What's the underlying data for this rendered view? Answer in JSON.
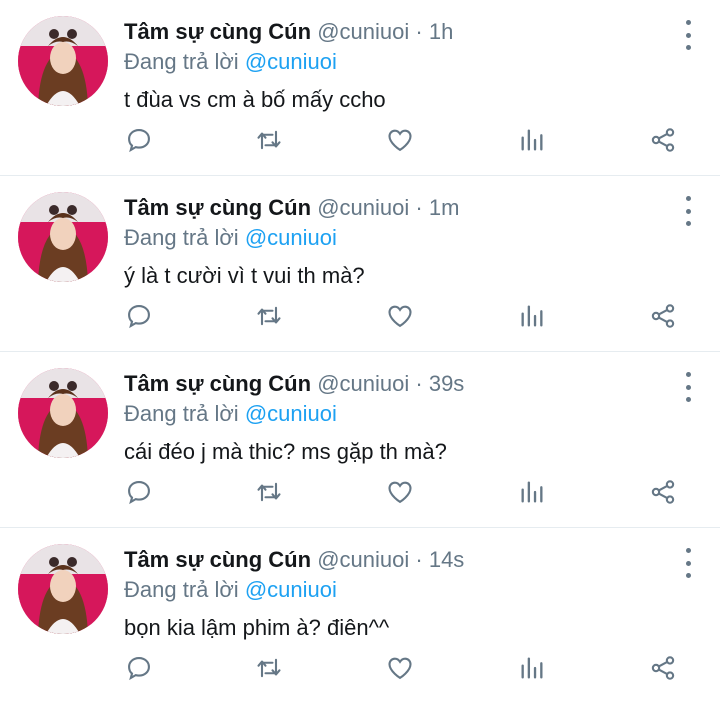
{
  "tweets": [
    {
      "name": "Tâm sự cùng Cún",
      "handle": "@cuniuoi",
      "dot": "·",
      "time": "1h",
      "reply_prefix": "Đang trả lời",
      "reply_to": "@cuniuoi",
      "text": "t đùa vs cm à bố mấy ccho"
    },
    {
      "name": "Tâm sự cùng Cún",
      "handle": "@cuniuoi",
      "dot": "·",
      "time": "1m",
      "reply_prefix": "Đang trả lời",
      "reply_to": "@cuniuoi",
      "text": "ý là t cười vì t vui th mà?"
    },
    {
      "name": "Tâm sự cùng Cún",
      "handle": "@cuniuoi",
      "dot": "·",
      "time": "39s",
      "reply_prefix": "Đang trả lời",
      "reply_to": "@cuniuoi",
      "text": "cái đéo j mà thic? ms gặp th mà?"
    },
    {
      "name": "Tâm sự cùng Cún",
      "handle": "@cuniuoi",
      "dot": "·",
      "time": "14s",
      "reply_prefix": "Đang trả lời",
      "reply_to": "@cuniuoi",
      "text": "bọn kia lậm phim à? điên^^"
    }
  ],
  "icons": {
    "reply": "reply-icon",
    "retweet": "retweet-icon",
    "like": "heart-icon",
    "stats": "stats-icon",
    "share": "share-icon",
    "more": "more-vertical-icon"
  },
  "colors": {
    "text_primary": "#14171a",
    "text_secondary": "#657786",
    "mention": "#1da1f2",
    "divider": "#e6ecf0"
  }
}
